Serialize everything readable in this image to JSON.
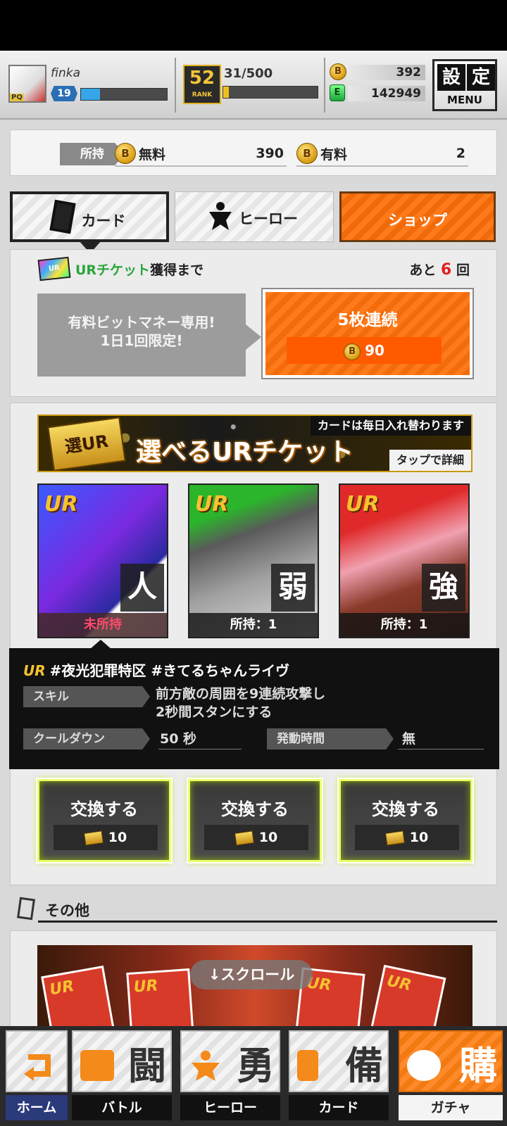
{
  "header": {
    "username": "finka",
    "level": "19",
    "level_progress": 0.22,
    "rank": "52",
    "rank_label": "RANK",
    "rank_progress_text": "31/500",
    "rank_progress": 0.062,
    "coins": "392",
    "energy": "142949",
    "settings_kanji_1": "設",
    "settings_kanji_2": "定",
    "settings_menu": "MENU",
    "avatar_tag": "PQ"
  },
  "balance": {
    "owned_label": "所持",
    "free_label": "無料",
    "free_value": "390",
    "paid_label": "有料",
    "paid_value": "2"
  },
  "tabs": {
    "card": "カード",
    "hero": "ヒーロー",
    "shop": "ショップ"
  },
  "ur_ticket": {
    "title_green": "URチケット",
    "title_rest": "獲得まで",
    "remaining_prefix": "あと",
    "remaining_count": "6",
    "remaining_suffix": "回",
    "paid_note_line1": "有料ビットマネー専用!",
    "paid_note_line2": "1日1回限定!",
    "gacha5_label": "5枚連続",
    "gacha5_cost": "90"
  },
  "select_ur": {
    "banner_badge": "選UR",
    "banner_title": "選べるURチケット",
    "banner_daily": "カードは毎日入れ替わります",
    "banner_detail": "タップで詳細",
    "cards": [
      {
        "rarity": "UR",
        "attr": "人",
        "owned": "未所持"
      },
      {
        "rarity": "UR",
        "attr": "弱",
        "owned": "所持：1"
      },
      {
        "rarity": "UR",
        "attr": "強",
        "owned": "所持：1"
      }
    ],
    "selected_card": {
      "rarity": "UR",
      "name": "#夜光犯罪特区 #きてるちゃんライヴ",
      "skill_label": "スキル",
      "skill_line1": "前方敵の周囲を9連続攻撃し",
      "skill_line2": "2秒間スタンにする",
      "cooldown_label": "クールダウン",
      "cooldown_value": "50 秒",
      "duration_label": "発動時間",
      "duration_value": "無"
    },
    "exchange": [
      {
        "label": "交換する",
        "cost": "10"
      },
      {
        "label": "交換する",
        "cost": "10"
      },
      {
        "label": "交換する",
        "cost": "10"
      }
    ]
  },
  "other": {
    "title": "その他",
    "scroll_hint": "↓スクロール"
  },
  "nav": {
    "home": "ホーム",
    "battle": "バトル",
    "battle_kanji": "闘",
    "hero": "ヒーロー",
    "hero_kanji": "勇",
    "card": "カード",
    "card_kanji": "備",
    "gacha": "ガチャ",
    "gacha_kanji": "購"
  },
  "colors": {
    "accent_orange": "#f36c0c",
    "ur_gold": "#f6c230",
    "ticket_green": "#2aa53a",
    "count_red": "#e02020"
  }
}
